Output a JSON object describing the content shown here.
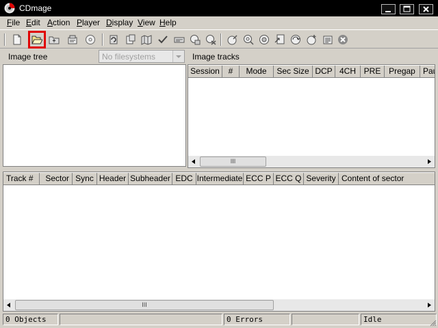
{
  "window": {
    "title": "CDmage",
    "controls": [
      "minimize",
      "maximize",
      "close"
    ]
  },
  "menu": {
    "file": {
      "u": "F",
      "rest": "ile"
    },
    "edit": {
      "u": "E",
      "rest": "dit"
    },
    "action": {
      "u": "A",
      "rest": "ction"
    },
    "player": {
      "u": "P",
      "rest": "layer"
    },
    "display": {
      "u": "D",
      "rest": "isplay"
    },
    "view": {
      "u": "V",
      "rest": "iew"
    },
    "help": {
      "u": "H",
      "rest": "elp"
    }
  },
  "toolbar": {
    "buttons": [
      "new-icon",
      "open-icon",
      "up-folder-icon",
      "properties-icon",
      "disc-icon",
      "refresh-icon",
      "copy-sectors-icon",
      "map-icon",
      "check-icon",
      "find-icon",
      "save-icon",
      "save-track-icon",
      "play-icon",
      "search-icon",
      "zoom-icon",
      "extract-icon",
      "convert-icon",
      "record-icon",
      "list-icon",
      "stop-icon"
    ],
    "selected": "open-icon",
    "highlight_color": "#e00000"
  },
  "image_tree": {
    "label": "Image tree",
    "filesystem_placeholder": "No filesystems"
  },
  "image_tracks": {
    "label": "Image tracks",
    "columns": [
      "Session",
      "#",
      "Mode",
      "Sec Size",
      "DCP",
      "4CH",
      "PRE",
      "Pregap",
      "Pau"
    ]
  },
  "sectors": {
    "columns": [
      "Track #",
      "Sector",
      "Sync",
      "Header",
      "Subheader",
      "EDC",
      "Intermediate",
      "ECC P",
      "ECC Q",
      "Severity",
      "Content of sector"
    ]
  },
  "scroll_thumb_glyph": "III",
  "status": {
    "objects": "0 Objects",
    "middle": "",
    "errors": "0 Errors",
    "blank": "",
    "state": "Idle"
  }
}
